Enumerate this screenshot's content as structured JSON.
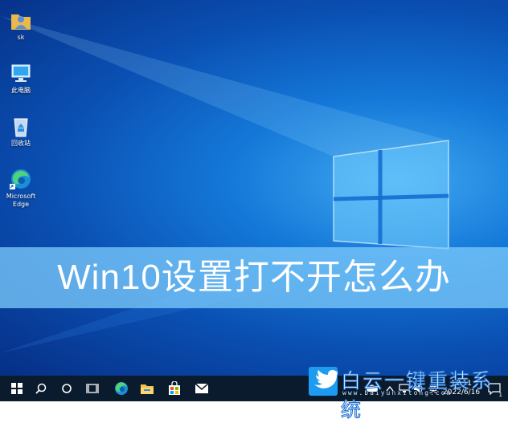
{
  "desktop": {
    "icons": [
      {
        "label": "sk",
        "icon": "user-folder-icon"
      },
      {
        "label": "此电脑",
        "icon": "computer-icon"
      },
      {
        "label": "回收站",
        "icon": "recycle-bin-icon"
      },
      {
        "label": "Microsoft Edge",
        "icon": "edge-icon"
      }
    ]
  },
  "banner": {
    "title": "Win10设置打不开怎么办"
  },
  "taskbar": {
    "items": [
      "start-icon",
      "search-icon",
      "cortana-icon",
      "task-view-icon",
      "edge-icon",
      "file-explorer-icon",
      "store-icon",
      "mail-icon"
    ],
    "tray": {
      "ime": "英",
      "time": "11:11",
      "date": "2022/6/16",
      "notification_count": "1"
    }
  },
  "watermark": {
    "brand": "白云一键重装系统",
    "url": "www.baiyunxitong.com"
  },
  "colors": {
    "taskbar": "#0b1b2e",
    "banner": "#78c8fa",
    "accent": "#1d9bf0"
  }
}
